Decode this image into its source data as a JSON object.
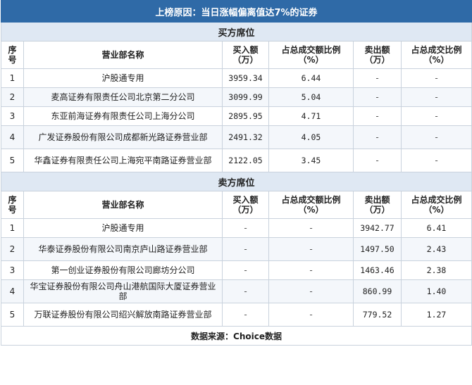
{
  "title": "上榜原因：当日涨幅偏离值达7%的证券",
  "buy": {
    "section_title": "买方席位",
    "headers": [
      "序号",
      "营业部名称",
      "买入额（万）",
      "占总成交额比例（%）",
      "卖出额（万）",
      "占总成交比例（%）"
    ],
    "rows": [
      {
        "no": "1",
        "name": "沪股通专用",
        "buy": "3959.34",
        "buy_pct": "6.44",
        "sell": "-",
        "sell_pct": "-"
      },
      {
        "no": "2",
        "name": "麦高证券有限责任公司北京第二分公司",
        "buy": "3099.99",
        "buy_pct": "5.04",
        "sell": "-",
        "sell_pct": "-"
      },
      {
        "no": "3",
        "name": "东亚前海证券有限责任公司上海分公司",
        "buy": "2895.95",
        "buy_pct": "4.71",
        "sell": "-",
        "sell_pct": "-"
      },
      {
        "no": "4",
        "name": "广发证券股份有限公司成都新光路证券营业部",
        "buy": "2491.32",
        "buy_pct": "4.05",
        "sell": "-",
        "sell_pct": "-"
      },
      {
        "no": "5",
        "name": "华鑫证券有限责任公司上海宛平南路证券营业部",
        "buy": "2122.05",
        "buy_pct": "3.45",
        "sell": "-",
        "sell_pct": "-"
      }
    ]
  },
  "sell": {
    "section_title": "卖方席位",
    "headers": [
      "序号",
      "营业部名称",
      "买入额（万）",
      "占总成交额比例（%）",
      "卖出额（万）",
      "占总成交比例（%）"
    ],
    "rows": [
      {
        "no": "1",
        "name": "沪股通专用",
        "buy": "-",
        "buy_pct": "-",
        "sell": "3942.77",
        "sell_pct": "6.41"
      },
      {
        "no": "2",
        "name": "华泰证券股份有限公司南京庐山路证券营业部",
        "buy": "-",
        "buy_pct": "-",
        "sell": "1497.50",
        "sell_pct": "2.43"
      },
      {
        "no": "3",
        "name": "第一创业证券股份有限公司廊坊分公司",
        "buy": "-",
        "buy_pct": "-",
        "sell": "1463.46",
        "sell_pct": "2.38"
      },
      {
        "no": "4",
        "name": "华宝证券股份有限公司舟山港航国际大厦证券营业部",
        "buy": "-",
        "buy_pct": "-",
        "sell": "860.99",
        "sell_pct": "1.40"
      },
      {
        "no": "5",
        "name": "万联证券股份有限公司绍兴解放南路证券营业部",
        "buy": "-",
        "buy_pct": "-",
        "sell": "779.52",
        "sell_pct": "1.27"
      }
    ]
  },
  "footer": "数据来源：Choice数据"
}
